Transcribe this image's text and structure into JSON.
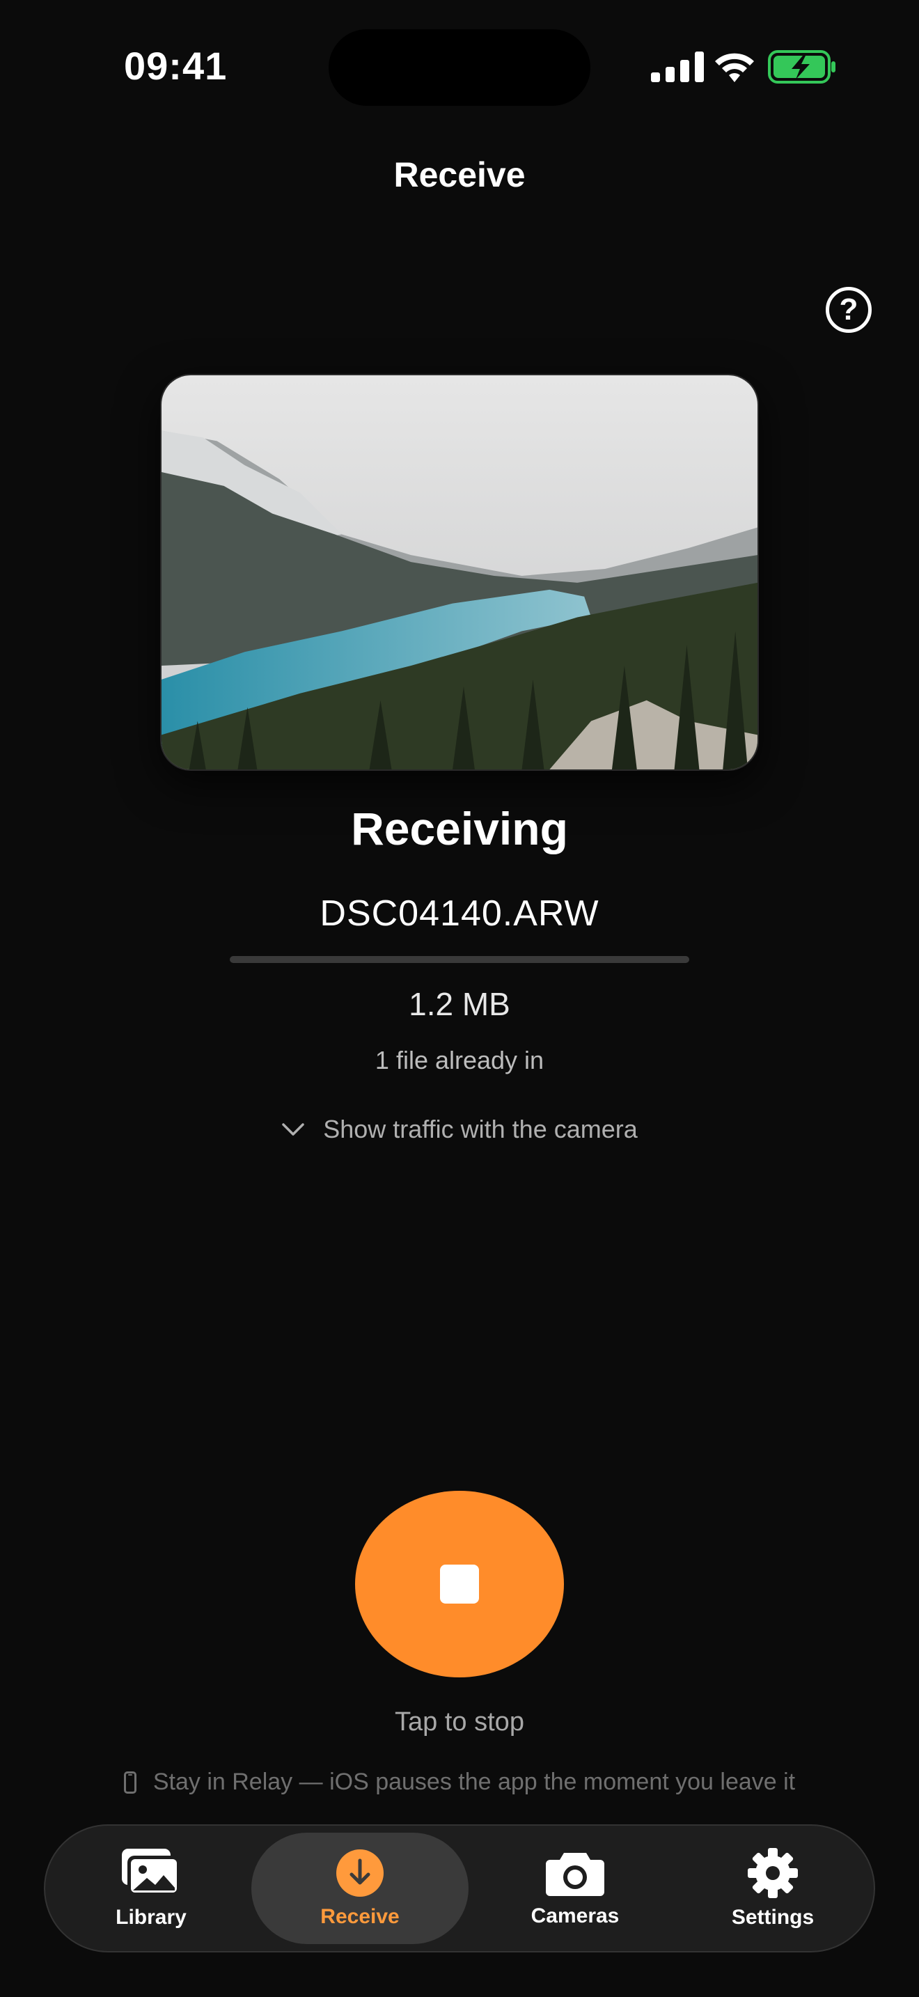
{
  "status_bar": {
    "time": "09:41"
  },
  "header": {
    "title": "Receive",
    "help_icon": "question-circle-icon",
    "help_glyph": "?"
  },
  "transfer": {
    "heading": "Receiving",
    "file_name": "DSC04140.ARW",
    "progress": 0.0,
    "file_size": "1.2 MB",
    "files_already_in": "1 file already in",
    "traffic_toggle_label": "Show traffic with the camera"
  },
  "stop": {
    "hint": "Tap to stop"
  },
  "notice": {
    "text": "Stay in Relay — iOS pauses the app the moment you leave it"
  },
  "tab_bar": {
    "active": "Receive",
    "accent_color": "#ff9a3c",
    "items": [
      {
        "label": "Library",
        "icon": "photo-stack-icon"
      },
      {
        "label": "Receive",
        "icon": "download-circle-icon"
      },
      {
        "label": "Cameras",
        "icon": "camera-icon"
      },
      {
        "label": "Settings",
        "icon": "gear-icon"
      }
    ]
  },
  "colors": {
    "background": "#0b0b0b",
    "stop_button": "#ff8c2a",
    "battery_fill": "#34c759"
  }
}
